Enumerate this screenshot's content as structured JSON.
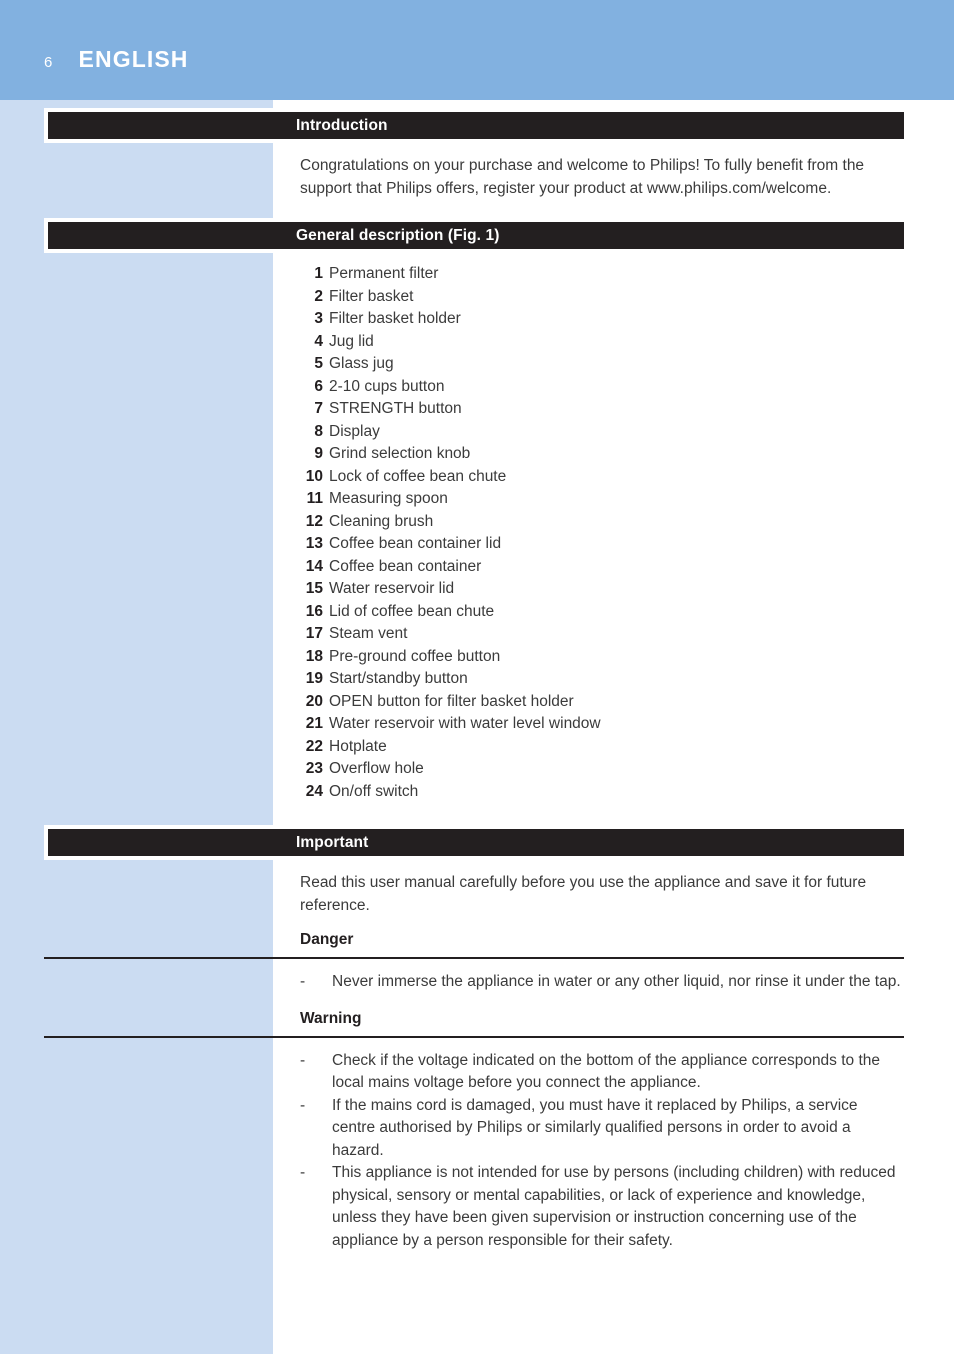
{
  "header": {
    "page_number": "6",
    "language_title": "ENGLISH",
    "band_color": "#82b1e0",
    "side_column_color": "#cbdcf2"
  },
  "theme": {
    "bar_color": "#231f20",
    "body_text_color": "#3b3b3b",
    "heading_color": "#231f20"
  },
  "sections": {
    "introduction": {
      "title": "Introduction",
      "paragraph": "Congratulations on your purchase and welcome to Philips! To fully benefit from the support that Philips offers, register your product at www.philips.com/welcome."
    },
    "general_description": {
      "title": "General description (Fig. 1)",
      "items": [
        {
          "num": "1",
          "label": "Permanent filter"
        },
        {
          "num": "2",
          "label": "Filter basket"
        },
        {
          "num": "3",
          "label": "Filter basket holder"
        },
        {
          "num": "4",
          "label": "Jug lid"
        },
        {
          "num": "5",
          "label": "Glass jug"
        },
        {
          "num": "6",
          "label": "2-10 cups button"
        },
        {
          "num": "7",
          "label": "STRENGTH button"
        },
        {
          "num": "8",
          "label": "Display"
        },
        {
          "num": "9",
          "label": "Grind selection knob"
        },
        {
          "num": "10",
          "label": "Lock of coffee bean chute"
        },
        {
          "num": "11",
          "label": "Measuring spoon"
        },
        {
          "num": "12",
          "label": "Cleaning brush"
        },
        {
          "num": "13",
          "label": "Coffee bean container lid"
        },
        {
          "num": "14",
          "label": "Coffee bean container"
        },
        {
          "num": "15",
          "label": "Water reservoir lid"
        },
        {
          "num": "16",
          "label": "Lid of coffee bean chute"
        },
        {
          "num": "17",
          "label": "Steam vent"
        },
        {
          "num": "18",
          "label": "Pre-ground coffee button"
        },
        {
          "num": "19",
          "label": "Start/standby button"
        },
        {
          "num": "20",
          "label": "OPEN button for filter basket holder"
        },
        {
          "num": "21",
          "label": "Water reservoir with water level window"
        },
        {
          "num": "22",
          "label": "Hotplate"
        },
        {
          "num": "23",
          "label": "Overflow hole"
        },
        {
          "num": "24",
          "label": "On/off switch"
        }
      ]
    },
    "important": {
      "title": "Important",
      "paragraph": "Read this user manual carefully before you use the appliance and save it for future reference.",
      "danger": {
        "heading": "Danger",
        "bullet_mark": "-",
        "bullets": [
          "Never immerse the appliance in water or any other liquid, nor rinse it under the tap."
        ]
      },
      "warning": {
        "heading": "Warning",
        "bullet_mark": "-",
        "bullets": [
          "Check if the voltage indicated on the bottom of the appliance corresponds to the local mains voltage before you connect the appliance.",
          "If the mains cord is damaged, you must have it replaced by Philips, a service centre authorised by Philips or similarly qualified persons in order to avoid a hazard.",
          "This appliance is not intended for use by persons (including children) with reduced physical, sensory or mental capabilities, or lack of experience and knowledge, unless they have been given supervision or instruction concerning use of the appliance by a person responsible for their safety."
        ]
      }
    }
  }
}
